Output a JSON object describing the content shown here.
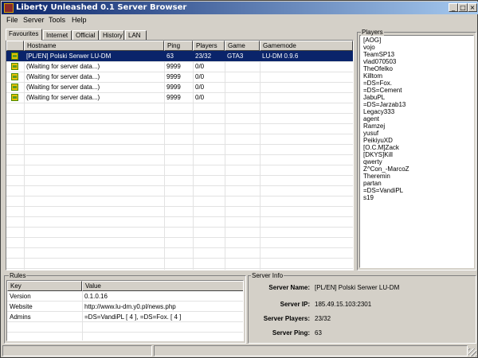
{
  "window": {
    "title": "Liberty Unleashed 0.1 Server Browser"
  },
  "titlebar_buttons": {
    "minimize": "_",
    "maximize": "□",
    "close": "×"
  },
  "menu": [
    "File",
    "Server",
    "Tools",
    "Help"
  ],
  "tabs": [
    "Favourites",
    "Internet",
    "Official",
    "History",
    "LAN"
  ],
  "active_tab": "Favourites",
  "server_list": {
    "columns": [
      "Hostname",
      "Ping",
      "Players",
      "Game",
      "Gamemode"
    ],
    "rows": [
      {
        "hostname": "[PL/EN] Polski Serwer LU-DM",
        "ping": "63",
        "players": "23/32",
        "game": "GTA3",
        "gamemode": "LU-DM 0.9.6",
        "selected": true
      },
      {
        "hostname": "(Waiting for server data...)",
        "ping": "9999",
        "players": "0/0",
        "game": "",
        "gamemode": "",
        "selected": false
      },
      {
        "hostname": "(Waiting for server data...)",
        "ping": "9999",
        "players": "0/0",
        "game": "",
        "gamemode": "",
        "selected": false
      },
      {
        "hostname": "(Waiting for server data...)",
        "ping": "9999",
        "players": "0/0",
        "game": "",
        "gamemode": "",
        "selected": false
      },
      {
        "hostname": "(Waiting for server data...)",
        "ping": "9999",
        "players": "0/0",
        "game": "",
        "gamemode": "",
        "selected": false
      }
    ]
  },
  "players": {
    "title": "Players",
    "names": [
      "[AOG]",
      "vojo",
      "TeamSP13",
      "vlad070503",
      "TheOfelko",
      "Killtom",
      "=DS=Fox.",
      "=DS=Cement",
      "JabuPL",
      "=DS=Jarzab13",
      "Legacy333",
      "agent",
      "Ramzej",
      "yusuf",
      "PeikiyuXD",
      "[O.C.M]Zack",
      "[DKYS]Kill",
      "qwerty",
      "Z^Con_-MarcoZ",
      "Theremin",
      "partan",
      "=DS=VandiPL",
      "s19"
    ]
  },
  "rules": {
    "title": "Rules",
    "columns": [
      "Key",
      "Value"
    ],
    "rows": [
      {
        "key": "Version",
        "value": "0.1.0.16"
      },
      {
        "key": "Website",
        "value": "http://www.lu-dm.y0.pl/news.php"
      },
      {
        "key": "Admins",
        "value": "=DS=VandiPL [ 4 ], =DS=Fox. [ 4 ]"
      }
    ]
  },
  "server_info": {
    "title": "Server Info",
    "name_label": "Server Name:",
    "name": "[PL/EN] Polski Serwer LU-DM",
    "ip_label": "Server IP:",
    "ip": "185.49.15.103:2301",
    "players_label": "Server Players:",
    "players": "23/32",
    "ping_label": "Server Ping:",
    "ping": "63"
  },
  "colors": {
    "selection": "#0a246a",
    "title_start": "#0a246a",
    "title_end": "#a6caf0",
    "face": "#d4d0c8"
  }
}
